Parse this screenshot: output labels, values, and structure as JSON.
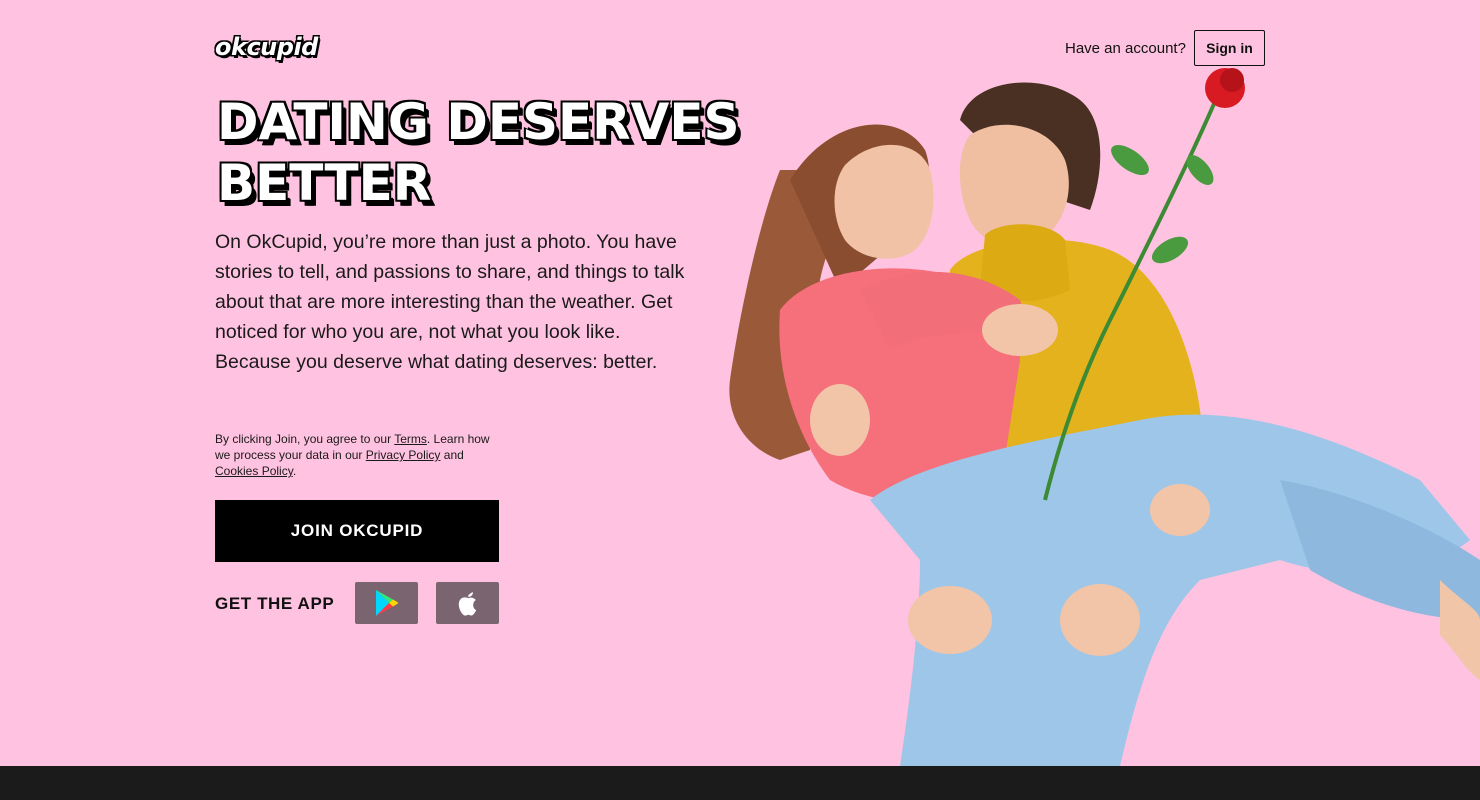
{
  "header": {
    "logo_text": "okcupid",
    "have_account": "Have an account?",
    "sign_in": "Sign in"
  },
  "hero": {
    "headline_line1": "DATING DESERVES",
    "headline_line2": "BETTER",
    "description": "On OkCupid, you’re more than just a photo. You have stories to tell, and passions to share, and things to talk about that are more interesting than the weather. Get noticed for who you are, not what you look like. Because you deserve what dating deserves: better."
  },
  "legal": {
    "prefix": "By clicking Join, you agree to our ",
    "terms": "Terms",
    "middle": ". Learn how we process your data in our ",
    "privacy": "Privacy Policy",
    "and": " and ",
    "cookies": "Cookies Policy",
    "suffix": "."
  },
  "cta": {
    "join": "JOIN OKCUPID",
    "get_app": "GET THE APP",
    "google_play_icon": "google-play-icon",
    "apple_icon": "apple-icon"
  },
  "colors": {
    "background": "#ffc2e0",
    "button": "#000000",
    "store_button": "#7a6470",
    "footer": "#1b1b1b"
  }
}
